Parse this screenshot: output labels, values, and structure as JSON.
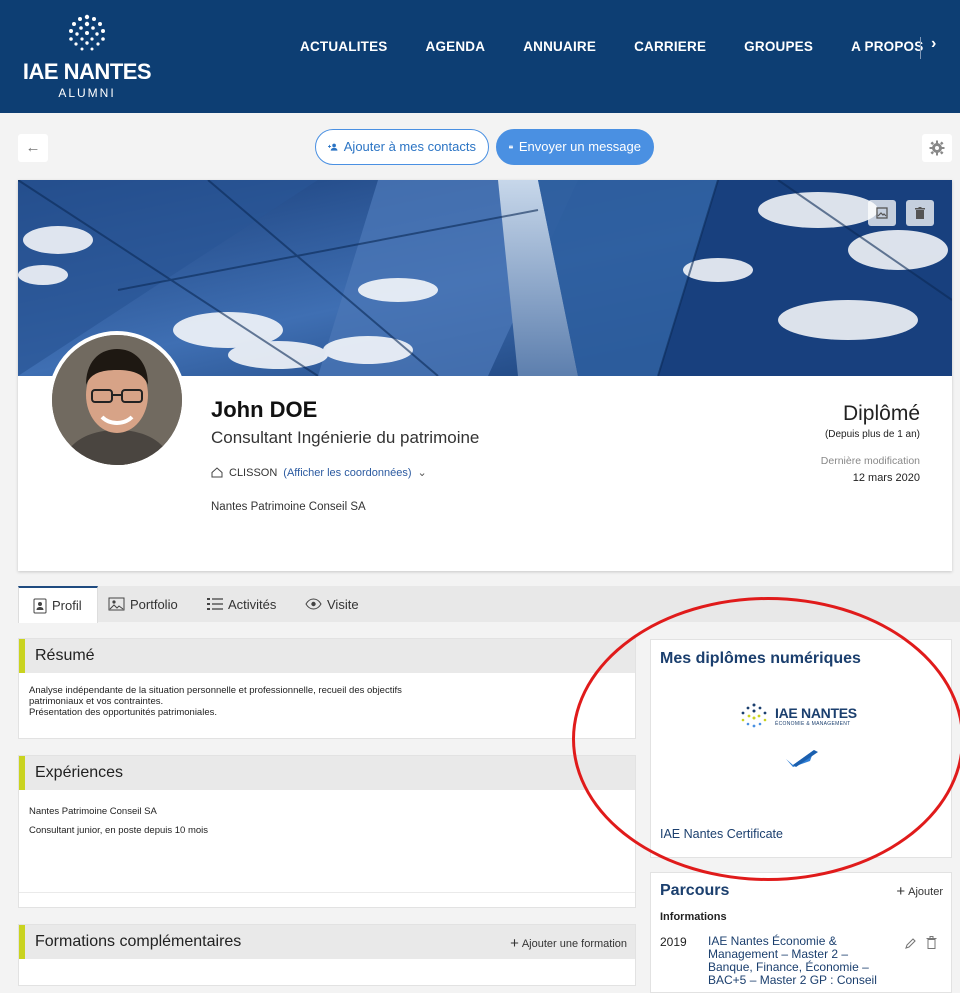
{
  "header": {
    "logo_main": "IAE NANTES",
    "logo_sub": "ALUMNI",
    "nav": [
      "ACTUALITES",
      "AGENDA",
      "ANNUAIRE",
      "CARRIERE",
      "GROUPES",
      "A PROPOS"
    ],
    "more_icon": "chevron-right-icon"
  },
  "actions": {
    "back": "←",
    "add_contact": "Ajouter à mes contacts",
    "send_message": "Envoyer un message"
  },
  "profile": {
    "name": "John DOE",
    "title": "Consultant Ingénierie du patrimoine",
    "location": "CLISSON",
    "show_contact": "(Afficher les coordonnées)",
    "company": "Nantes Patrimoine Conseil SA",
    "status": "Diplômé",
    "status_since": "(Depuis plus de 1 an)",
    "modified_label": "Dernière modification",
    "modified_date": "12 mars 2020"
  },
  "tabs": [
    "Profil",
    "Portfolio",
    "Activités",
    "Visite"
  ],
  "resume": {
    "title": "Résumé",
    "lines": [
      "Analyse indépendante de la situation personnelle et professionnelle, recueil des objectifs",
      "patrimoniaux et vos contraintes.",
      "Présentation des opportunités patrimoniales."
    ]
  },
  "experiences": {
    "title": "Expériences",
    "company": "Nantes Patrimoine Conseil SA",
    "role": "Consultant junior, en poste depuis 10 mois"
  },
  "formations": {
    "title": "Formations complémentaires",
    "add": "Ajouter une formation"
  },
  "diplomes": {
    "title": "Mes diplômes numériques",
    "logo_main": "IAE NANTES",
    "logo_sub": "ÉCONOMIE & MANAGEMENT",
    "certificate": "IAE Nantes Certificate"
  },
  "parcours": {
    "title": "Parcours",
    "add": "Ajouter",
    "subtitle": "Informations",
    "year": "2019",
    "text": "IAE Nantes Économie & Management – Master 2 – Banque, Finance, Économie – BAC+5 – Master 2 GP : Conseil"
  },
  "colors": {
    "header": "#0d3e73",
    "accent_blue": "#4a90e2",
    "section_bar": "#c9d31f",
    "highlight": "#e01b1b"
  }
}
